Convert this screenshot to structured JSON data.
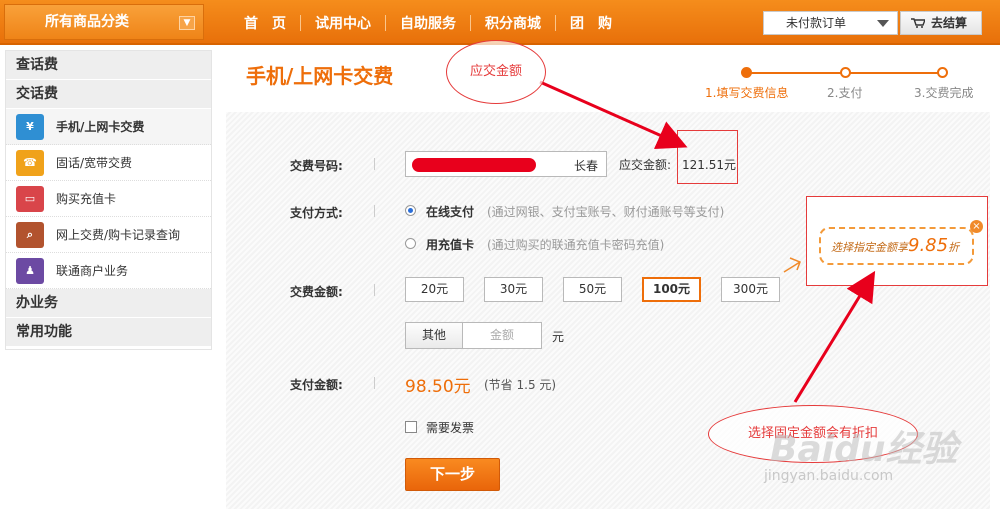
{
  "topbar": {
    "category_label": "所有商品分类",
    "nav": [
      "首　页",
      "试用中心",
      "自助服务",
      "积分商城",
      "团　购"
    ],
    "order_select": "未付款订单",
    "checkout": "去结算"
  },
  "sidebar": {
    "sections": [
      "查话费",
      "交话费",
      "办业务",
      "常用功能"
    ],
    "items": [
      {
        "label": "手机/上网卡交费",
        "icon": "phone-card-icon",
        "color": "#2f8fd3"
      },
      {
        "label": "固话/宽带交费",
        "icon": "landline-icon",
        "color": "#f0a21a"
      },
      {
        "label": "购买充值卡",
        "icon": "recharge-card-icon",
        "color": "#d9454a"
      },
      {
        "label": "网上交费/购卡记录查询",
        "icon": "record-search-icon",
        "color": "#b2532e"
      },
      {
        "label": "联通商户业务",
        "icon": "merchant-icon",
        "color": "#6c4aa3"
      }
    ]
  },
  "main": {
    "title": "手机/上网卡交费",
    "steps": [
      "1.填写交费信息",
      "2.支付",
      "3.交费完成"
    ],
    "phone_label": "交费号码:",
    "city": "长春",
    "due_label": "应交金额:",
    "due_amount": "121.51元",
    "pay_method_label": "支付方式:",
    "online_pay": "在线支付",
    "online_note": "(通过网银、支付宝账号、财付通账号等支付)",
    "card_pay": "用充值卡",
    "card_note": "(通过购买的联通充值卡密码充值)",
    "amount_label": "交费金额:",
    "amounts": [
      "20元",
      "30元",
      "50元",
      "100元",
      "300元"
    ],
    "selected_amount_index": 3,
    "other_label": "其他",
    "amount_placeholder": "金额",
    "unit": "元",
    "pay_total_label": "支付金额:",
    "pay_total": "98.50元",
    "save_note": "(节省 1.5 元)",
    "invoice_label": "需要发票",
    "next_button": "下一步"
  },
  "promo": {
    "text": "选择指定金额享",
    "discount": "9.85",
    "suffix": "折"
  },
  "annotations": {
    "oval1": "应交金额",
    "oval2": "选择固定金额会有折扣"
  },
  "watermark": {
    "brand": "Baidu经验",
    "url": "jingyan.baidu.com"
  }
}
